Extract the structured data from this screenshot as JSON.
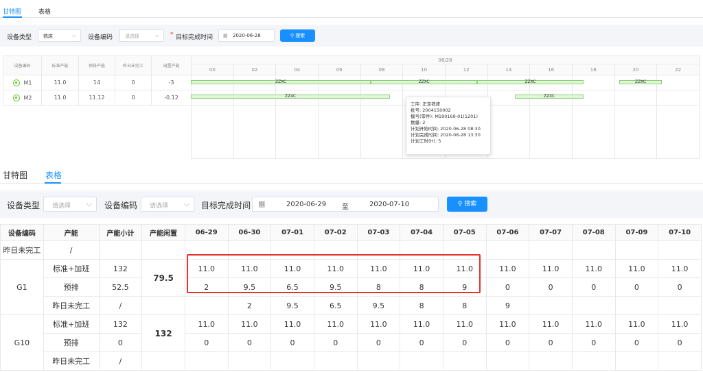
{
  "top": {
    "tabs": [
      {
        "label": "甘特图",
        "active": true
      },
      {
        "label": "表格",
        "active": false
      }
    ],
    "filter": {
      "device_type_label": "设备类型",
      "device_type_value": "铣床",
      "device_code_label": "设备编码",
      "device_code_placeholder": "请选择",
      "required_mark": "*",
      "target_time_label": "目标完成时间",
      "target_date": "2020-06-28",
      "search_label": "搜索"
    },
    "table": {
      "headers": [
        "设备编码",
        "标准产能",
        "预排产能",
        "昨日未完工",
        "闲置产能"
      ],
      "date_header": "06/28",
      "hours": [
        "00",
        "02",
        "04",
        "06",
        "08",
        "10",
        "12",
        "14",
        "16",
        "18",
        "20",
        "22"
      ],
      "rows": [
        {
          "code": "M1",
          "standard": "11.0",
          "prearranged": "14",
          "yesterday": "0",
          "idle": "-3"
        },
        {
          "code": "M2",
          "standard": "11.0",
          "prearranged": "11.12",
          "yesterday": "0",
          "idle": "-0.12"
        }
      ],
      "bar_label": "ZZXC"
    },
    "tooltip": {
      "lines": [
        "工序: 正定铣床",
        "批号: 2004150002",
        "模号(零件): M190169-01(1201)",
        "数量: 2",
        "计划开始时间: 2020-06-28 08:30",
        "计划完成时间: 2020-06-28 13:30",
        "计划工时(H): 5"
      ]
    }
  },
  "bottom": {
    "tabs": [
      {
        "label": "甘特图",
        "active": false
      },
      {
        "label": "表格",
        "active": true
      }
    ],
    "filter": {
      "device_type_label": "设备类型",
      "device_type_placeholder": "请选择",
      "device_code_label": "设备编码",
      "device_code_placeholder": "请选择",
      "target_time_label": "目标完成时间",
      "date_from": "2020-06-29",
      "range_sep": "至",
      "date_to": "2020-07-10",
      "search_label": "搜索"
    },
    "table": {
      "headers": [
        "设备编码",
        "产能",
        "产能小计",
        "产能闲置",
        "06-29",
        "06-30",
        "07-01",
        "07-02",
        "07-03",
        "07-04",
        "07-05",
        "07-06",
        "07-07",
        "07-08",
        "07-09",
        "07-10"
      ],
      "top_row": {
        "label": "昨日未完工",
        "slash": "/"
      },
      "groups": [
        {
          "code": "G1",
          "idle": "79.5",
          "rows": [
            {
              "label": "标准+加班",
              "subtotal": "132",
              "values": [
                "11.0",
                "11.0",
                "11.0",
                "11.0",
                "11.0",
                "11.0",
                "11.0",
                "11.0",
                "11.0",
                "11.0",
                "11.0",
                "11.0"
              ]
            },
            {
              "label": "预排",
              "subtotal": "52.5",
              "values": [
                "2",
                "9.5",
                "6.5",
                "9.5",
                "8",
                "8",
                "9",
                "0",
                "0",
                "0",
                "0",
                "0"
              ]
            },
            {
              "label": "昨日未完工",
              "subtotal": "/",
              "values": [
                "",
                "2",
                "9.5",
                "6.5",
                "9.5",
                "8",
                "8",
                "9",
                "",
                "",
                "",
                ""
              ]
            }
          ]
        },
        {
          "code": "G10",
          "idle": "132",
          "rows": [
            {
              "label": "标准+加班",
              "subtotal": "132",
              "values": [
                "11.0",
                "11.0",
                "11.0",
                "11.0",
                "11.0",
                "11.0",
                "11.0",
                "11.0",
                "11.0",
                "11.0",
                "11.0",
                "11.0"
              ]
            },
            {
              "label": "预排",
              "subtotal": "0",
              "values": [
                "0",
                "0",
                "0",
                "0",
                "0",
                "0",
                "0",
                "0",
                "0",
                "0",
                "0",
                "0"
              ]
            },
            {
              "label": "昨日未完工",
              "subtotal": "/",
              "values": [
                "",
                "",
                "",
                "",
                "",
                "",
                "",
                "",
                "",
                "",
                "",
                ""
              ]
            }
          ]
        }
      ]
    }
  },
  "colors": {
    "accent": "#1890ff",
    "idle_negative": "#f5222d",
    "highlight_box": "#e5322d",
    "gantt_bar": "#dff6d8"
  }
}
